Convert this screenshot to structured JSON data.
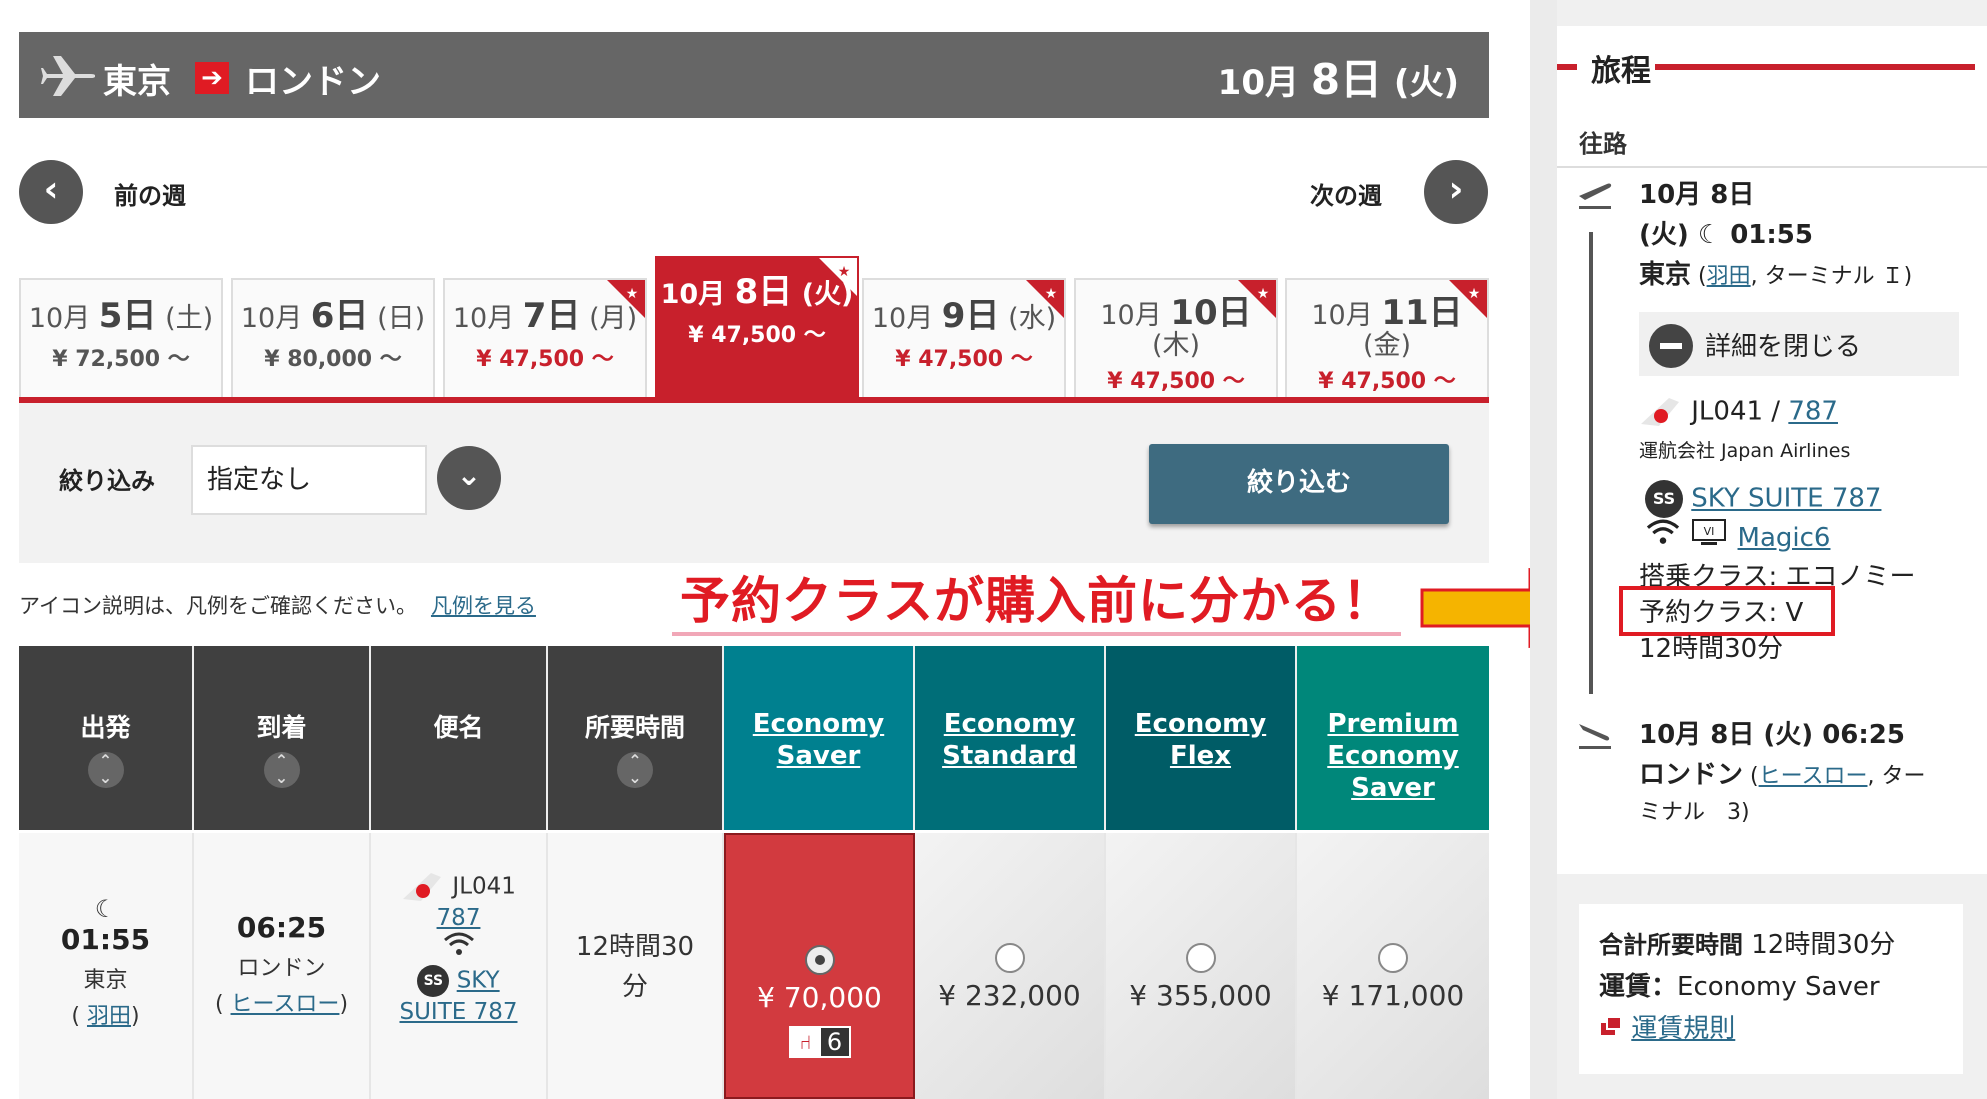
{
  "route": {
    "from": "東京",
    "arrow": "➔",
    "to": "ロンドン",
    "date_month": "10月",
    "date_day": "8日",
    "date_weekday": "(火)"
  },
  "week_nav": {
    "prev_label": "前の週",
    "next_label": "次の週"
  },
  "date_tabs": [
    {
      "month": "10月",
      "day": "5日",
      "weekday": "(土)",
      "price": "¥ 72,500 ～",
      "red": false
    },
    {
      "month": "10月",
      "day": "6日",
      "weekday": "(日)",
      "price": "¥ 80,000 ～",
      "red": false
    },
    {
      "month": "10月",
      "day": "7日",
      "weekday": "(月)",
      "price": "¥ 47,500 ～",
      "red": true
    },
    {
      "month": "10月",
      "day": "8日",
      "weekday": "(火)",
      "price": "¥ 47,500 ～",
      "red": true,
      "active": true
    },
    {
      "month": "10月",
      "day": "9日",
      "weekday": "(水)",
      "price": "¥ 47,500 ～",
      "red": true
    },
    {
      "month": "10月",
      "day": "10日",
      "weekday": "(木)",
      "price": "¥ 47,500 ～",
      "red": true
    },
    {
      "month": "10月",
      "day": "11日",
      "weekday": "(金)",
      "price": "¥ 47,500 ～",
      "red": true
    }
  ],
  "filter": {
    "label": "絞り込み",
    "selected": "指定なし",
    "button": "絞り込む"
  },
  "legend": {
    "text": "アイコン説明は、凡例をご確認ください。",
    "link": "凡例を見る"
  },
  "annotation": "予約クラスが購入前に分かる！",
  "table": {
    "headers": [
      "出発",
      "到着",
      "便名",
      "所要時間"
    ],
    "fare_headers": [
      {
        "line1": "Economy",
        "line2": "Saver",
        "line3": "",
        "color": "#00808f"
      },
      {
        "line1": "Economy",
        "line2": "Standard",
        "line3": "",
        "color": "#006e78"
      },
      {
        "line1": "Economy",
        "line2": "Flex",
        "line3": "",
        "color": "#005c66"
      },
      {
        "line1": "Premium",
        "line2": "Economy",
        "line3": "Saver",
        "color": "#00877a"
      }
    ],
    "row": {
      "dep_time": "01:55",
      "dep_city": "東京",
      "dep_airport": "羽田",
      "arr_time": "06:25",
      "arr_city": "ロンドン",
      "arr_airport": "ヒースロー",
      "flight_no": "JL041",
      "aircraft": "787",
      "ss": "SS",
      "suite_line1": "SKY",
      "suite_line2": "SUITE 787",
      "duration_line1": "12時間30",
      "duration_line2": "分",
      "fares": [
        "¥ 70,000",
        "¥ 232,000",
        "¥ 355,000",
        "¥ 171,000"
      ],
      "seats_left": "6"
    }
  },
  "sidebar": {
    "title": "旅程",
    "subtitle": "往路",
    "dep_date": "10月 8日",
    "dep_weekday": "(火)",
    "dep_time": "01:55",
    "dep_city": "東京",
    "dep_airport": "羽田",
    "dep_terminal": ", ターミナル Ｉ)",
    "detail_btn": "詳細を閉じる",
    "flight_no": "JL041 /",
    "aircraft": "787",
    "operator": "運航会社 Japan Airlines",
    "ss": "SS",
    "suite": "SKY SUITE 787",
    "magic": "Magic6",
    "cabin": "搭乗クラス: エコノミー",
    "booking_class": "予約クラス: V",
    "duration": "12時間30分",
    "arr_line": "10月 8日 (火) 06:25",
    "arr_city": "ロンドン",
    "arr_airport": "ヒースロー",
    "arr_terminal_1": ", ター",
    "arr_terminal_2": "ミナル　3)",
    "total_label": "合計所要時間",
    "total_value": "12時間30分",
    "fare_label": "運賃：",
    "fare_value": "Economy Saver",
    "rules_link": "運賃規則"
  }
}
